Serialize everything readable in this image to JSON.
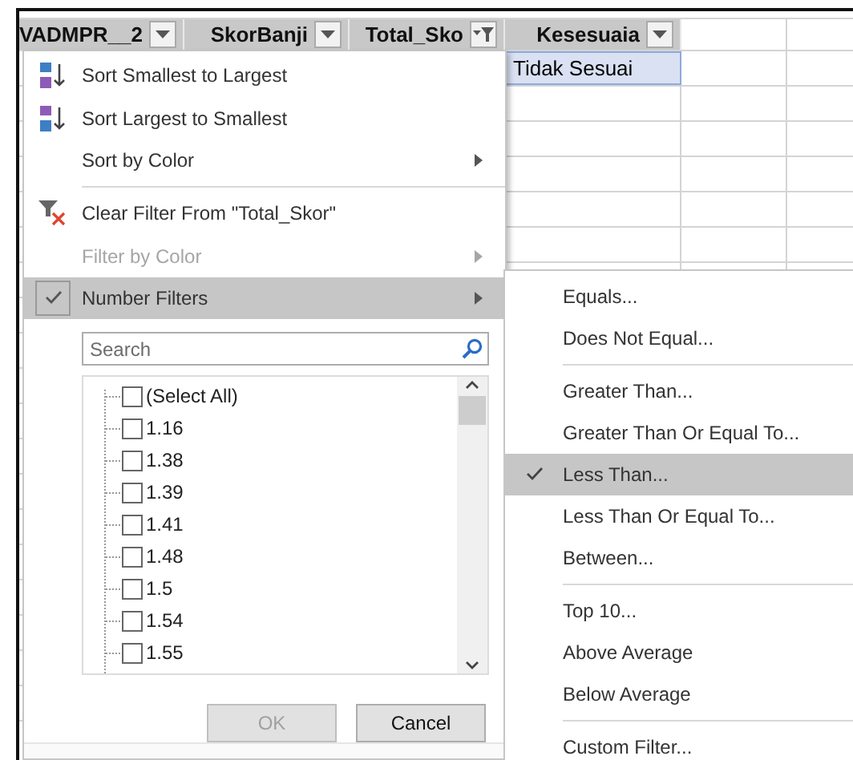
{
  "columns": [
    {
      "label": "VADMPR__2",
      "filtered": false
    },
    {
      "label": "SkorBanji",
      "filtered": false
    },
    {
      "label": "Total_Sko",
      "filtered": true
    },
    {
      "label": "Kesesuaia",
      "filtered": false
    }
  ],
  "cell": {
    "text": "Tidak Sesuai",
    "selected": true
  },
  "menu": {
    "items": [
      {
        "kind": "sort_up",
        "label": "Sort Smallest to Largest",
        "submenu": false,
        "disabled": false,
        "checked": false
      },
      {
        "kind": "sort_down",
        "label": "Sort Largest to Smallest",
        "submenu": false,
        "disabled": false,
        "checked": false
      },
      {
        "kind": "plain",
        "label": "Sort by Color",
        "submenu": true,
        "disabled": false,
        "checked": false
      },
      {
        "kind": "separator"
      },
      {
        "kind": "clear",
        "label": "Clear Filter From \"Total_Skor\"",
        "submenu": false,
        "disabled": false,
        "checked": false
      },
      {
        "kind": "plain",
        "label": "Filter by Color",
        "submenu": true,
        "disabled": true,
        "checked": false
      },
      {
        "kind": "plain",
        "label": "Number Filters",
        "submenu": true,
        "disabled": false,
        "checked": true
      }
    ],
    "search": {
      "placeholder": "Search"
    },
    "values": [
      {
        "label": "(Select All)",
        "checked": false
      },
      {
        "label": "1.16",
        "checked": false
      },
      {
        "label": "1.38",
        "checked": false
      },
      {
        "label": "1.39",
        "checked": false
      },
      {
        "label": "1.41",
        "checked": false
      },
      {
        "label": "1.48",
        "checked": false
      },
      {
        "label": "1.5",
        "checked": false
      },
      {
        "label": "1.54",
        "checked": false
      },
      {
        "label": "1.55",
        "checked": false
      }
    ],
    "buttons": [
      {
        "label": "OK",
        "disabled": true
      },
      {
        "label": "Cancel",
        "disabled": false
      }
    ]
  },
  "submenu": {
    "items": [
      {
        "kind": "item",
        "label": "Equals...",
        "selected": false
      },
      {
        "kind": "item",
        "label": "Does Not Equal...",
        "selected": false
      },
      {
        "kind": "separator"
      },
      {
        "kind": "item",
        "label": "Greater Than...",
        "selected": false
      },
      {
        "kind": "item",
        "label": "Greater Than Or Equal To...",
        "selected": false
      },
      {
        "kind": "item",
        "label": "Less Than...",
        "selected": true
      },
      {
        "kind": "item",
        "label": "Less Than Or Equal To...",
        "selected": false
      },
      {
        "kind": "item",
        "label": "Between...",
        "selected": false
      },
      {
        "kind": "separator"
      },
      {
        "kind": "item",
        "label": "Top 10...",
        "selected": false
      },
      {
        "kind": "item",
        "label": "Above Average",
        "selected": false
      },
      {
        "kind": "item",
        "label": "Below Average",
        "selected": false
      },
      {
        "kind": "separator"
      },
      {
        "kind": "item",
        "label": "Custom Filter...",
        "selected": false
      }
    ]
  }
}
